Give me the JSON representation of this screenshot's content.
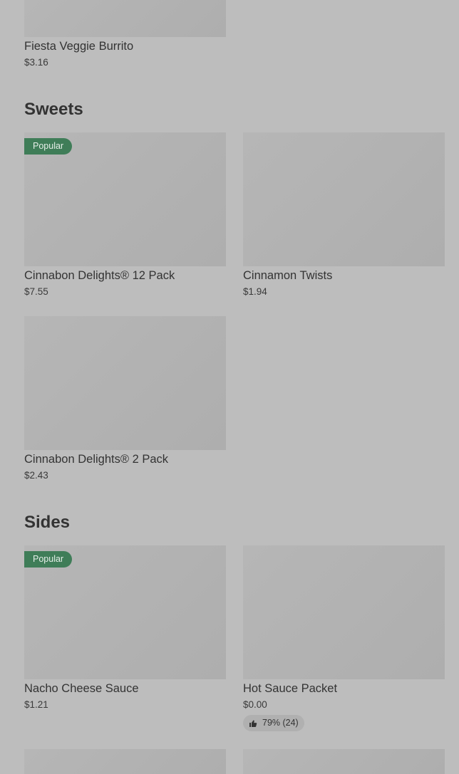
{
  "sections": {
    "sweets": {
      "title": "Sweets"
    },
    "sides": {
      "title": "Sides"
    }
  },
  "items": {
    "fiesta_veggie_burrito": {
      "name": "Fiesta Veggie Burrito",
      "price": "$3.16"
    },
    "cinnabon_12": {
      "name": "Cinnabon Delights® 12 Pack",
      "price": "$7.55",
      "badge": "Popular"
    },
    "cinnamon_twists": {
      "name": "Cinnamon Twists",
      "price": "$1.94"
    },
    "cinnabon_2": {
      "name": "Cinnabon Delights® 2 Pack",
      "price": "$2.43"
    },
    "nacho_cheese": {
      "name": "Nacho Cheese Sauce",
      "price": "$1.21",
      "badge": "Popular"
    },
    "hot_sauce": {
      "name": "Hot Sauce Packet",
      "price": "$0.00",
      "rating": "79% (24)"
    }
  },
  "icons": {
    "rating_icon": "thumbs-up-icon"
  },
  "colors": {
    "background": "#bdbdbd",
    "badge": "#3f7d58",
    "placeholder": "#b2b2b2"
  }
}
